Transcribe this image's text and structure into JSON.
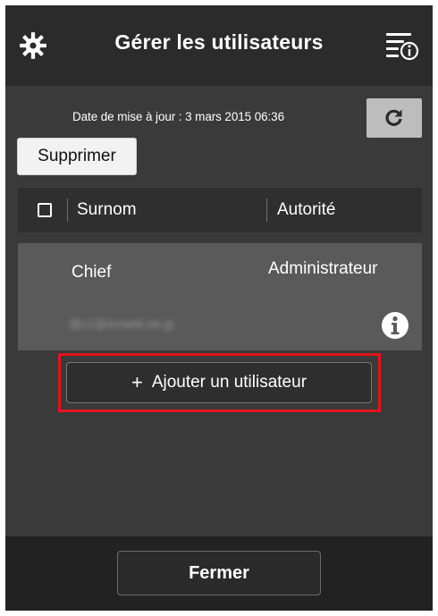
{
  "header": {
    "title": "Gérer les utilisateurs",
    "settings_icon": "gear-icon",
    "info_menu_icon": "info-menu-icon"
  },
  "update": {
    "text": "Date de mise à jour : 3 mars 2015 06:36",
    "refresh_icon": "refresh-icon"
  },
  "actions": {
    "delete_label": "Supprimer"
  },
  "table": {
    "columns": [
      "Surnom",
      "Autorité"
    ]
  },
  "users": [
    {
      "nickname": "Chief",
      "authority": "Administrateur",
      "email": "@c1@ezweb.ne.jp"
    }
  ],
  "add_user": {
    "label": "Ajouter un utilisateur",
    "icon": "+"
  },
  "footer": {
    "close_label": "Fermer"
  },
  "colors": {
    "highlight": "#e4141c",
    "background": "#3a3a3a",
    "header": "#2b2b2b"
  }
}
